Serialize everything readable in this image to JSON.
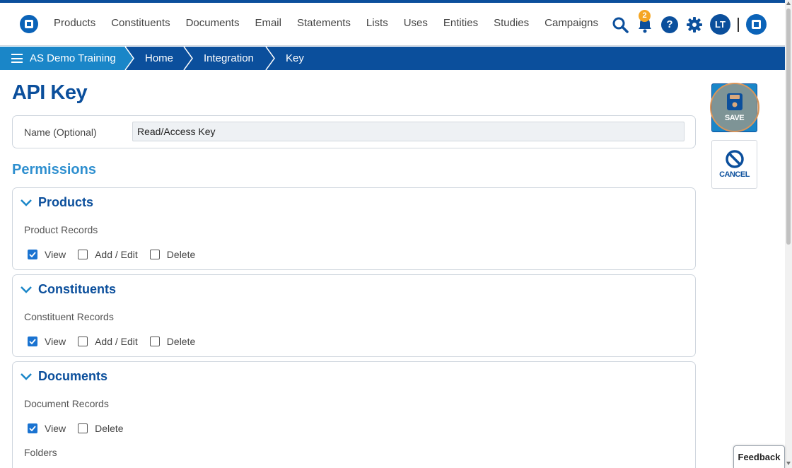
{
  "nav": {
    "links": [
      "Products",
      "Constituents",
      "Documents",
      "Email",
      "Statements",
      "Lists",
      "Uses",
      "Entities",
      "Studies",
      "Campaigns"
    ],
    "notification_count": "2",
    "help_label": "?",
    "avatar_initials": "LT"
  },
  "breadcrumb": {
    "items": [
      "AS Demo Training",
      "Home",
      "Integration",
      "Key"
    ]
  },
  "page": {
    "title": "API Key"
  },
  "name_field": {
    "label": "Name (Optional)",
    "value": "Read/Access Key"
  },
  "permissions_heading": "Permissions",
  "sections": [
    {
      "title": "Products",
      "subtitle": "Product Records",
      "options": [
        {
          "label": "View",
          "checked": true
        },
        {
          "label": "Add / Edit",
          "checked": false
        },
        {
          "label": "Delete",
          "checked": false
        }
      ]
    },
    {
      "title": "Constituents",
      "subtitle": "Constituent Records",
      "options": [
        {
          "label": "View",
          "checked": true
        },
        {
          "label": "Add / Edit",
          "checked": false
        },
        {
          "label": "Delete",
          "checked": false
        }
      ]
    },
    {
      "title": "Documents",
      "subtitle": "Document Records",
      "options": [
        {
          "label": "View",
          "checked": true
        },
        {
          "label": "Delete",
          "checked": false
        }
      ],
      "subtitle2": "Folders"
    }
  ],
  "actions": {
    "save_label": "SAVE",
    "cancel_label": "CANCEL"
  },
  "feedback_label": "Feedback",
  "colors": {
    "brand_dark": "#0b4f9c",
    "brand_light": "#1a86c8",
    "accent_heading": "#2e8fcf",
    "badge": "#f5a623"
  },
  "icons": [
    "logo-icon",
    "search-icon",
    "bell-icon",
    "help-icon",
    "gear-icon",
    "save-icon",
    "cancel-icon",
    "hamburger-icon",
    "chevron-down-icon"
  ]
}
